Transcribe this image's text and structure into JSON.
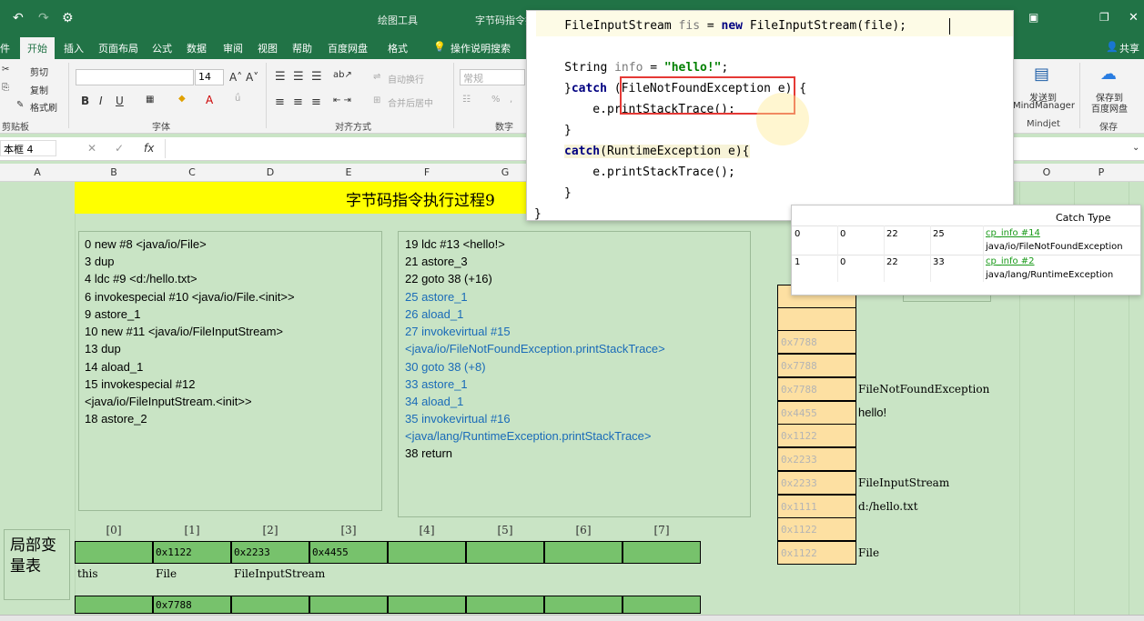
{
  "window": {
    "title_tools": "绘图工具",
    "title_doc": "字节码指令执"
  },
  "ribbon": {
    "tabs": [
      "件",
      "开始",
      "插入",
      "页面布局",
      "公式",
      "数据",
      "审阅",
      "视图",
      "帮助",
      "百度网盘",
      "格式"
    ],
    "active_tab": "开始",
    "tell_me": "操作说明搜索",
    "share": "共享",
    "clipboard": {
      "cut": "剪切",
      "copy": "复制",
      "format_painter": "格式刷",
      "group": "剪贴板"
    },
    "font": {
      "size": "14",
      "bold": "B",
      "italic": "I",
      "underline": "U",
      "group": "字体"
    },
    "alignment": {
      "wrap": "自动换行",
      "merge": "合并后居中",
      "group": "对齐方式"
    },
    "number": {
      "format": "常规",
      "group": "数字"
    },
    "mindmanager": {
      "label1": "发送到",
      "label2": "MindManager",
      "group": "Mindjet"
    },
    "baidu": {
      "label1": "保存到",
      "label2": "百度网盘",
      "group": "保存"
    }
  },
  "formula_bar": {
    "name_box": "本框 4",
    "fx": "fx"
  },
  "columns": [
    "A",
    "B",
    "C",
    "D",
    "E",
    "F",
    "G",
    "O",
    "P"
  ],
  "sheet": {
    "title": "字节码指令执行过程9",
    "code_left": [
      " 0 new #8 <java/io/File>",
      " 3 dup",
      " 4 ldc #9 <d:/hello.txt>",
      " 6 invokespecial #10 <java/io/File.<init>>",
      " 9 astore_1",
      "10 new #11 <java/io/FileInputStream>",
      "13 dup",
      "14 aload_1",
      "15 invokespecial #12",
      "<java/io/FileInputStream.<init>>",
      "18 astore_2"
    ],
    "code_right": [
      {
        "text": "19 ldc #13 <hello!>",
        "blue": false
      },
      {
        "text": "21 astore_3",
        "blue": false
      },
      {
        "text": "22 goto 38 (+16)",
        "blue": false
      },
      {
        "text": "25 astore_1",
        "blue": true
      },
      {
        "text": "26 aload_1",
        "blue": true
      },
      {
        "text": "27 invokevirtual #15",
        "blue": true
      },
      {
        "text": "<java/io/FileNotFoundException.printStackTrace>",
        "blue": true
      },
      {
        "text": "30 goto 38 (+8)",
        "blue": true
      },
      {
        "text": "33 astore_1",
        "blue": true
      },
      {
        "text": "34 aload_1",
        "blue": true
      },
      {
        "text": "35 invokevirtual #16",
        "blue": true
      },
      {
        "text": "<java/lang/RuntimeException.printStackTrace>",
        "blue": true
      },
      {
        "text": "38 return",
        "blue": false
      }
    ],
    "local_vars_label": "局部变量表",
    "slot_headers": [
      "[0]",
      "[1]",
      "[2]",
      "[3]",
      "[4]",
      "[5]",
      "[6]",
      "[7]"
    ],
    "slot_values": [
      "",
      "0x1122",
      "0x2233",
      "0x4455",
      "",
      "",
      "",
      ""
    ],
    "slot_names": [
      "this",
      "File",
      "FileInputStream",
      "",
      "",
      "",
      "",
      ""
    ],
    "slot_values_row2": [
      "",
      "0x7788",
      "",
      "",
      "",
      "",
      "",
      ""
    ],
    "stack": [
      {
        "addr": "",
        "label": ""
      },
      {
        "addr": "",
        "label": ""
      },
      {
        "addr": "0x7788",
        "label": ""
      },
      {
        "addr": "0x7788",
        "label": "FileNotFoundException"
      },
      {
        "addr": "0x4455",
        "label": "hello!"
      },
      {
        "addr": "0x1122",
        "label": ""
      },
      {
        "addr": "0x2233",
        "label": ""
      },
      {
        "addr": "0x2233",
        "label": "FileInputStream"
      },
      {
        "addr": "0x1111",
        "label": "d:/hello.txt"
      },
      {
        "addr": "0x1122",
        "label": ""
      },
      {
        "addr": "0x1122",
        "label": "File"
      }
    ]
  },
  "code_popup": {
    "lines": [
      {
        "pre": "    FileInputStream ",
        "var": "fis",
        "mid": " = ",
        "kw": "new",
        "post": " FileInputStream(file);"
      },
      {
        "pre": "    String ",
        "var": "info",
        "mid": " = ",
        "str": "\"hello!\"",
        "post": ";"
      },
      {
        "pre": "}",
        "kw": "catch",
        "post": " (FileNotFoundException e) {"
      },
      {
        "pre": "    e.printStackTrace();"
      },
      {
        "pre": "}"
      },
      {
        "kw": "catch",
        "post": "(RuntimeException e){"
      },
      {
        "pre": "    e.printStackTrace();"
      },
      {
        "pre": "}"
      },
      {
        "pre": "}"
      }
    ]
  },
  "exception_table": {
    "header": "Catch Type",
    "rows": [
      {
        "idx": "0",
        "start": "0",
        "end": "22",
        "handler": "25",
        "link": "cp_info #14",
        "type": "java/io/FileNotFoundException"
      },
      {
        "idx": "1",
        "start": "0",
        "end": "22",
        "handler": "33",
        "link": "cp_info #2",
        "type": "java/lang/RuntimeException"
      }
    ]
  },
  "colors": {
    "excel_green": "#217346",
    "sheet_bg": "#c9e4c5",
    "banner": "#ffff00",
    "slot": "#77c26c",
    "stack": "#fde0a2",
    "blue_text": "#1a6bb8",
    "highlight_box": "#e53935"
  }
}
